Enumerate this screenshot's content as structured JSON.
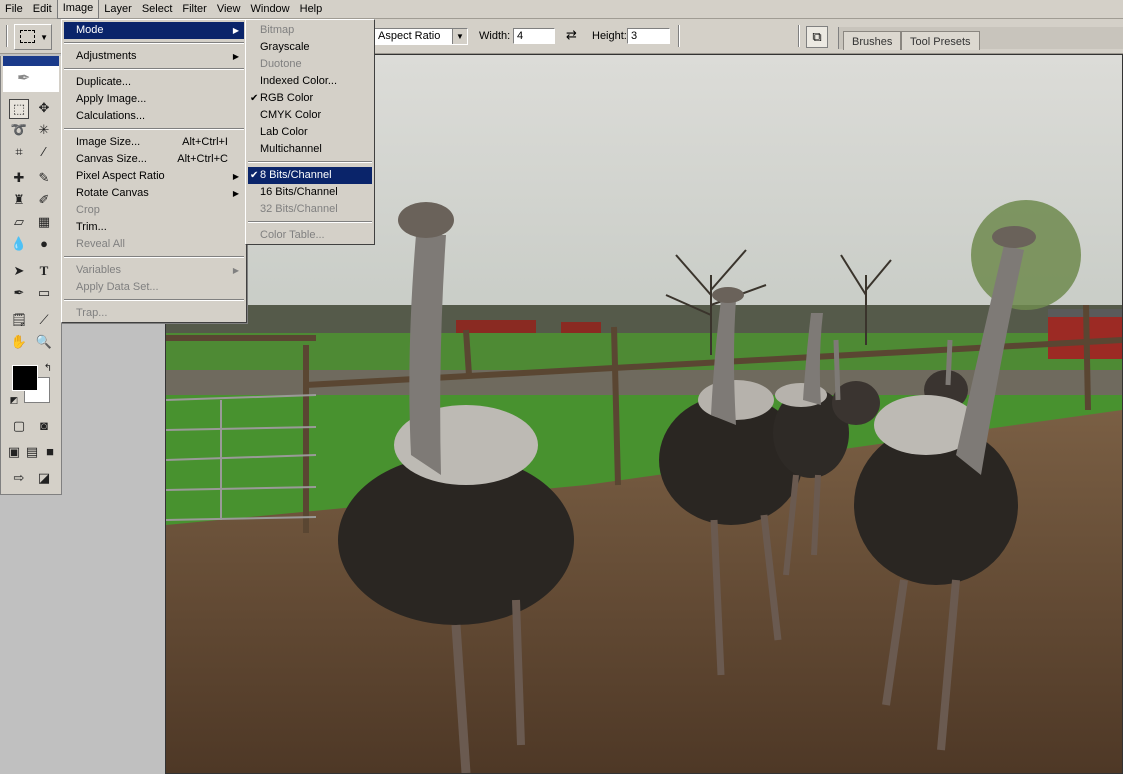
{
  "menubar": {
    "items": [
      "File",
      "Edit",
      "Image",
      "Layer",
      "Select",
      "Filter",
      "View",
      "Window",
      "Help"
    ],
    "active": "Image"
  },
  "options": {
    "style_value": "Aspect Ratio",
    "width_label": "Width:",
    "width_value": "4",
    "height_label": "Height:",
    "height_value": "3",
    "palette_tabs": [
      "Brushes",
      "Tool Presets"
    ]
  },
  "image_menu": {
    "items": [
      {
        "label": "Mode",
        "submenu": true,
        "highlighted": true
      },
      {
        "label": "Adjustments",
        "submenu": true
      },
      {
        "label": "Duplicate..."
      },
      {
        "label": "Apply Image..."
      },
      {
        "label": "Calculations..."
      },
      {
        "label": "Image Size...",
        "shortcut": "Alt+Ctrl+I"
      },
      {
        "label": "Canvas Size...",
        "shortcut": "Alt+Ctrl+C"
      },
      {
        "label": "Pixel Aspect Ratio",
        "submenu": true
      },
      {
        "label": "Rotate Canvas",
        "submenu": true
      },
      {
        "label": "Crop",
        "disabled": true
      },
      {
        "label": "Trim..."
      },
      {
        "label": "Reveal All",
        "disabled": true
      },
      {
        "label": "Variables",
        "submenu": true,
        "disabled": true
      },
      {
        "label": "Apply Data Set...",
        "disabled": true
      },
      {
        "label": "Trap...",
        "disabled": true
      }
    ]
  },
  "mode_menu": {
    "items": [
      {
        "label": "Bitmap",
        "disabled": true
      },
      {
        "label": "Grayscale"
      },
      {
        "label": "Duotone",
        "disabled": true
      },
      {
        "label": "Indexed Color..."
      },
      {
        "label": "RGB Color",
        "checked": true
      },
      {
        "label": "CMYK Color"
      },
      {
        "label": "Lab Color"
      },
      {
        "label": "Multichannel"
      },
      {
        "label": "8 Bits/Channel",
        "checked": true,
        "highlighted": true
      },
      {
        "label": "16 Bits/Channel"
      },
      {
        "label": "32 Bits/Channel",
        "disabled": true
      },
      {
        "label": "Color Table...",
        "disabled": true
      }
    ]
  },
  "toolbox": {
    "tools": [
      "marquee-icon",
      "move-icon",
      "lasso-icon",
      "magic-wand-icon",
      "crop-icon",
      "slice-icon",
      "healing-brush-icon",
      "brush-icon",
      "clone-stamp-icon",
      "history-brush-icon",
      "eraser-icon",
      "gradient-icon",
      "blur-icon",
      "dodge-icon",
      "path-selection-icon",
      "type-icon",
      "pen-icon",
      "shape-icon",
      "notes-icon",
      "eyedropper-icon",
      "hand-icon",
      "zoom-icon"
    ]
  },
  "colors": {
    "foreground": "#000000",
    "background": "#ffffff",
    "highlight": "#0a246a"
  }
}
